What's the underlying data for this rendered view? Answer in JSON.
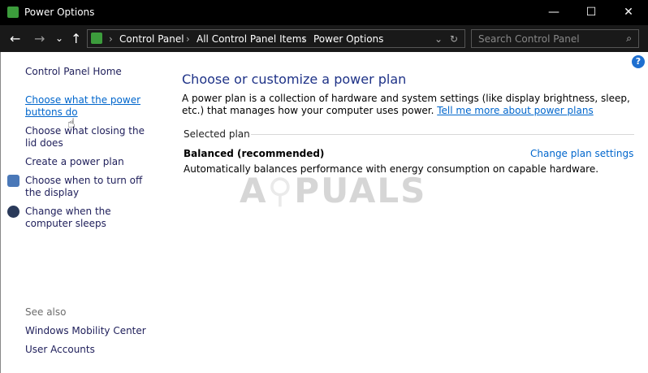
{
  "window": {
    "title": "Power Options",
    "minimize": "—",
    "maximize": "☐",
    "close": "✕"
  },
  "nav": {
    "back": "←",
    "forward": "→",
    "recent": "⌄",
    "up": "↑",
    "breadcrumb": [
      "Control Panel",
      "All Control Panel Items",
      "Power Options"
    ],
    "refresh": "↻",
    "search_placeholder": "Search Control Panel",
    "search_icon": "⌕"
  },
  "sidebar": {
    "home": "Control Panel Home",
    "links": [
      "Choose what the power buttons do",
      "Choose what closing the lid does",
      "Create a power plan",
      "Choose when to turn off the display",
      "Change when the computer sleeps"
    ],
    "see_also": "See also",
    "see_also_links": [
      "Windows Mobility Center",
      "User Accounts"
    ]
  },
  "main": {
    "heading": "Choose or customize a power plan",
    "description": "A power plan is a collection of hardware and system settings (like display brightness, sleep, etc.) that manages how your computer uses power.",
    "learn_more": "Tell me more about power plans",
    "selected_plan_label": "Selected plan",
    "plan_name": "Balanced (recommended)",
    "plan_description": "Automatically balances performance with energy consumption on capable hardware.",
    "change_settings": "Change plan settings",
    "help": "?"
  },
  "watermark": "A PUALS"
}
